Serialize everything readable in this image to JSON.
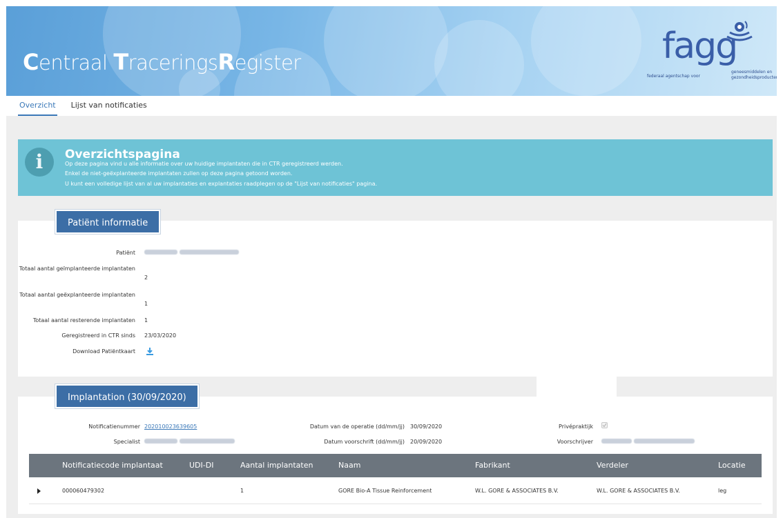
{
  "banner": {
    "title_parts": [
      {
        "big": "C",
        "small": "entraal "
      },
      {
        "big": "T",
        "small": "racerings"
      },
      {
        "big": "R",
        "small": "egister"
      }
    ],
    "logo_text": "fagg",
    "logo_sub_left": "federaal agentschap voor",
    "logo_sub_right": "geneesmiddelen en gezondheidsproducten"
  },
  "nav": {
    "tabs": [
      {
        "label": "Overzicht",
        "active": true
      },
      {
        "label": "Lijst van notificaties",
        "active": false
      }
    ]
  },
  "alert": {
    "icon": "info-icon",
    "title": "Overzichtspagina",
    "lines": [
      "Op deze pagina vind u alle informatie over uw huidige implantaten die in CTR geregistreerd werden.",
      "Enkel de niet-geëxplanteerde implantaten zullen op deze pagina getoond worden.",
      "U kunt een volledige lijst van al uw implantaties en explantaties raadplegen op de \"Lijst van notificaties\" pagina."
    ]
  },
  "patient": {
    "header": "Patiënt informatie",
    "rows": [
      {
        "label": "Patiënt",
        "value": ""
      },
      {
        "label": "Totaal aantal geïmplanteerde implantaten",
        "value": "2"
      },
      {
        "label": "Totaal aantal geëxplanteerde implantaten",
        "value": "1"
      },
      {
        "label": "Totaal aantal resterende implantaten",
        "value": "1"
      },
      {
        "label": "Geregistreerd in CTR sinds",
        "value": "23/03/2020"
      },
      {
        "label": "Download Patiëntkaart",
        "value": ""
      }
    ],
    "download_icon": "download-icon"
  },
  "implantation": {
    "header": "Implantation (30/09/2020)",
    "notification_label": "Notificatienummer",
    "notification_value": "202010023639605",
    "specialist_label": "Specialist",
    "operation_date_label": "Datum van de operatie (dd/mm/jj)",
    "operation_date_value": "30/09/2020",
    "prescription_date_label": "Datum voorschrift (dd/mm/jj)",
    "prescription_date_value": "20/09/2020",
    "private_label": "Privépraktijk",
    "private_checked": true,
    "prescriber_label": "Voorschrijver"
  },
  "table": {
    "columns": [
      "Notificatiecode implantaat",
      "UDI-DI",
      "Aantal implantaten",
      "Naam",
      "Fabrikant",
      "Verdeler",
      "Locatie"
    ],
    "rows": [
      [
        "000060479302",
        "",
        "1",
        "GORE Bio-A Tissue Reinforcement",
        "W.L. GORE & ASSOCIATES B.V.",
        "W.L. GORE & ASSOCIATES B.V.",
        "leg"
      ]
    ]
  },
  "colors": {
    "banner_blue": "#5a9fd8",
    "header_blue": "#3c6ea6",
    "alert_teal": "#6ec3d6",
    "table_head_gray": "#6c757e",
    "link_blue": "#3a78b8"
  }
}
